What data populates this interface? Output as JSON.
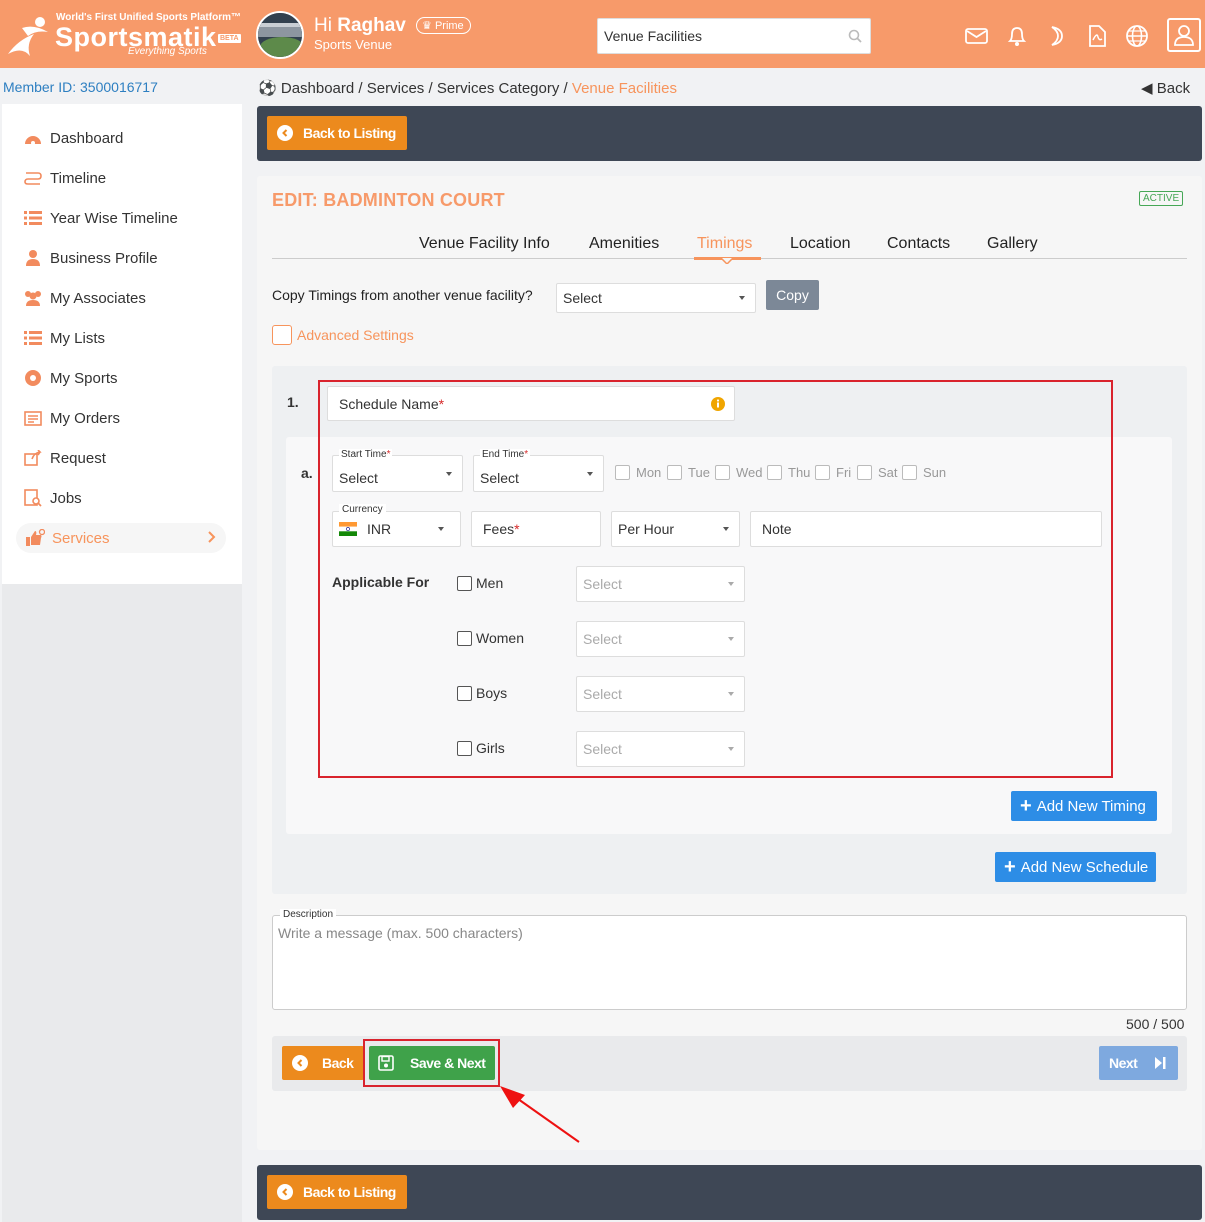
{
  "header": {
    "tagline": "World's First Unified Sports Platform™",
    "brand": "Sportsmatik",
    "beta": "BETA",
    "slogan": "Everything Sports",
    "greeting_prefix": "Hi ",
    "user_name": "Raghav",
    "prime_label": "Prime",
    "user_subtitle": "Sports Venue",
    "search_value": "Venue Facilities",
    "icons": [
      "mail-icon",
      "bell-icon",
      "moon-icon",
      "pdf-icon",
      "globe-icon",
      "user-icon"
    ],
    "color": "#f79a6a"
  },
  "member_id": "Member ID: 3500016717",
  "breadcrumb": {
    "items": [
      "Dashboard",
      "Services",
      "Services Category"
    ],
    "separator": " / ",
    "current": "Venue Facilities",
    "back_label": "Back"
  },
  "sidebar": {
    "items": [
      {
        "label": "Dashboard",
        "icon": "dashboard-icon"
      },
      {
        "label": "Timeline",
        "icon": "timeline-icon"
      },
      {
        "label": "Year Wise Timeline",
        "icon": "list-icon"
      },
      {
        "label": "Business Profile",
        "icon": "user-icon"
      },
      {
        "label": "My Associates",
        "icon": "users-icon"
      },
      {
        "label": "My Lists",
        "icon": "list-icon"
      },
      {
        "label": "My Sports",
        "icon": "ball-icon"
      },
      {
        "label": "My Orders",
        "icon": "orders-icon"
      },
      {
        "label": "Request",
        "icon": "request-icon"
      },
      {
        "label": "Jobs",
        "icon": "jobs-icon"
      },
      {
        "label": "Services",
        "icon": "services-icon",
        "active": true
      }
    ]
  },
  "back_to_listing": "Back to Listing",
  "form": {
    "title": "EDIT: BADMINTON COURT",
    "status": "ACTIVE",
    "tabs": [
      "Venue Facility Info",
      "Amenities",
      "Timings",
      "Location",
      "Contacts",
      "Gallery"
    ],
    "active_tab": "Timings",
    "copy_label": "Copy Timings from another venue facility?",
    "copy_select": "Select",
    "copy_button": "Copy",
    "advanced_label": "Advanced Settings",
    "schedule": {
      "number": "1.",
      "name_placeholder": "Schedule Name",
      "timing_letter": "a.",
      "start_time_label": "Start Time",
      "start_time_value": "Select",
      "end_time_label": "End Time",
      "end_time_value": "Select",
      "days": [
        "Mon",
        "Tue",
        "Wed",
        "Thu",
        "Fri",
        "Sat",
        "Sun"
      ],
      "currency_label": "Currency",
      "currency_value": "INR",
      "fees_placeholder": "Fees",
      "fee_period": "Per Hour",
      "note_placeholder": "Note",
      "applicable_label": "Applicable For",
      "applicable": [
        {
          "label": "Men",
          "select": "Select"
        },
        {
          "label": "Women",
          "select": "Select"
        },
        {
          "label": "Boys",
          "select": "Select"
        },
        {
          "label": "Girls",
          "select": "Select"
        }
      ],
      "add_timing": "Add New Timing",
      "add_schedule": "Add New Schedule"
    },
    "description_label": "Description",
    "description_placeholder": "Write a message (max. 500 characters)",
    "char_counter": "500 / 500",
    "back_button": "Back",
    "save_next_button": "Save & Next",
    "next_button": "Next"
  },
  "colors": {
    "accent": "#f7945c",
    "dark_bar": "#3e4755",
    "orange_btn": "#ec8a1d",
    "green_btn": "#3fa24a",
    "blue_btn": "#2d8de6",
    "highlight": "#d9232d"
  }
}
